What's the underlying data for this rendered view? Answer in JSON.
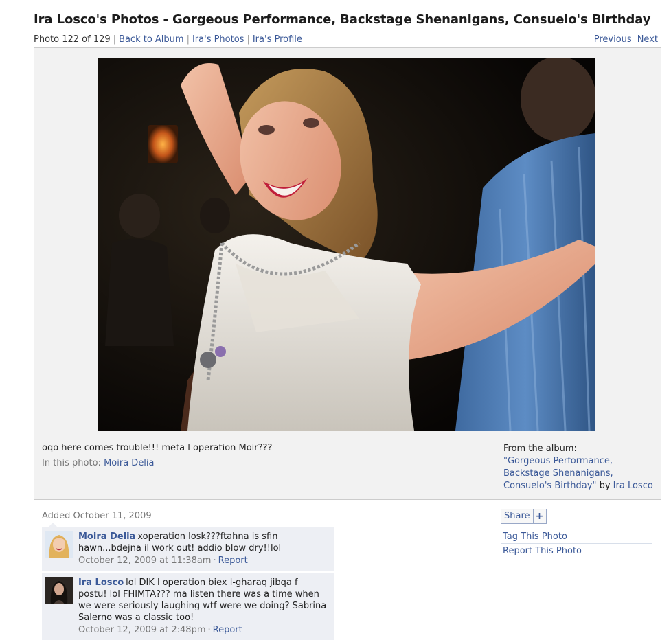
{
  "page": {
    "title": "Ira Losco's Photos - Gorgeous Performance, Backstage Shenanigans, Consuelo's Birthday"
  },
  "subnav": {
    "photo_count": "Photo 122 of 129",
    "back_to_album": "Back to Album",
    "owner_photos": "Ira's Photos",
    "owner_profile": "Ira's Profile"
  },
  "pager": {
    "previous": "Previous",
    "next": "Next"
  },
  "photo": {
    "caption": "oqo here comes trouble!!! meta l operation Moir???",
    "in_this_photo_label": "In this photo:",
    "tagged_person": "Moira Delia"
  },
  "album": {
    "from_label": "From the album:",
    "name": "\"Gorgeous Performance, Backstage Shenanigans, Consuelo's Birthday\"",
    "by_label": "by",
    "owner": "Ira Losco"
  },
  "added": "Added October 11, 2009",
  "comments": [
    {
      "author": "Moira Delia",
      "text": "xoperation losk???ftahna is sfin hawn...bdejna il work out! addio blow dry!!lol",
      "timestamp": "October 12, 2009 at 11:38am",
      "report": "Report",
      "avatar": "blonde-woman-avatar"
    },
    {
      "author": "Ira Losco",
      "text": "lol DIK l operation biex l-gharaq jibqa f postu! lol FHIMTA??? ma listen there was a time when we were seriously laughing wtf were we doing? Sabrina Salerno was a classic too!",
      "timestamp": "October 12, 2009 at 2:48pm",
      "report": "Report",
      "avatar": "dark-hair-woman-avatar"
    }
  ],
  "sidebar": {
    "share_label": "Share",
    "share_plus": "+",
    "tag_photo": "Tag This Photo",
    "report_photo": "Report This Photo"
  },
  "colors": {
    "link": "#3b5998",
    "panel_bg": "#f2f2f2",
    "comment_bg": "#edeff4"
  }
}
